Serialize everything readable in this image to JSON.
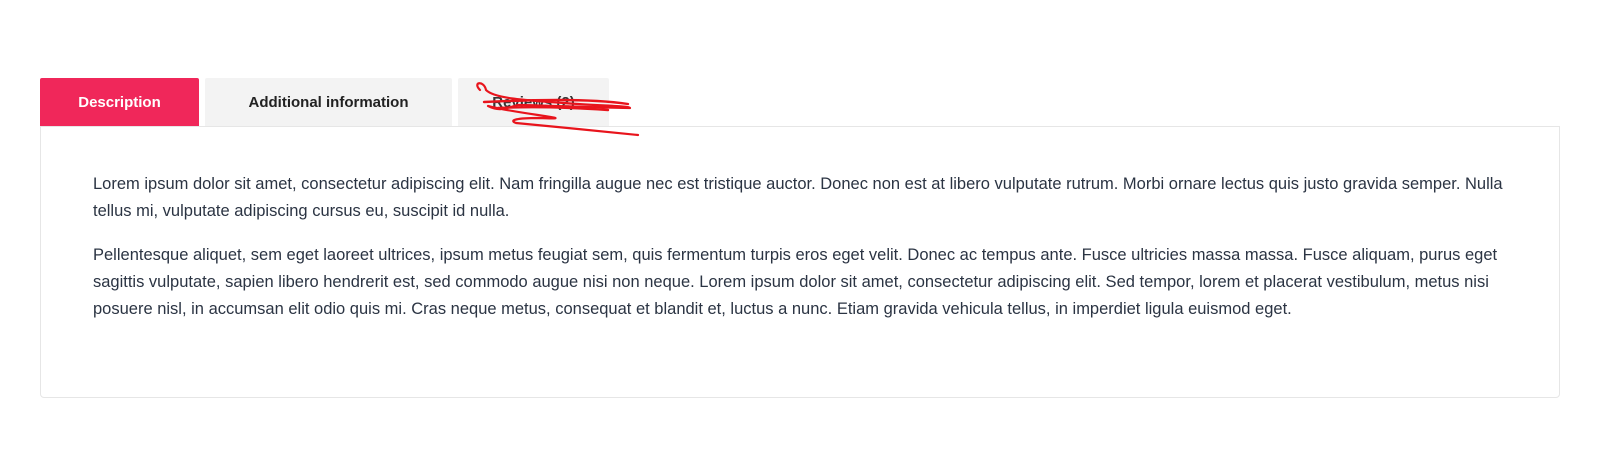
{
  "tabs": [
    {
      "label": "Description",
      "active": true
    },
    {
      "label": "Additional information",
      "active": false
    },
    {
      "label": "Reviews (2)",
      "active": false
    }
  ],
  "description": {
    "paragraphs": [
      "Lorem ipsum dolor sit amet, consectetur adipiscing elit. Nam fringilla augue nec est tristique auctor. Donec non est at libero vulputate rutrum. Morbi ornare lectus quis justo gravida semper. Nulla tellus mi, vulputate adipiscing cursus eu, suscipit id nulla.",
      "Pellentesque aliquet, sem eget laoreet ultrices, ipsum metus feugiat sem, quis fermentum turpis eros eget velit. Donec ac tempus ante. Fusce ultricies massa massa. Fusce aliquam, purus eget sagittis vulputate, sapien libero hendrerit est, sed commodo augue nisi non neque. Lorem ipsum dolor sit amet, consectetur adipiscing elit. Sed tempor, lorem et placerat vestibulum, metus nisi posuere nisl, in accumsan elit odio quis mi. Cras neque metus, consequat et blandit et, luctus a nunc. Etiam gravida vehicula tellus, in imperdiet ligula euismod eget."
    ]
  },
  "colors": {
    "accent": "#f0275a",
    "tab_inactive_bg": "#f3f3f3",
    "body_text": "#2b3443",
    "scribble": "#e8141c"
  }
}
